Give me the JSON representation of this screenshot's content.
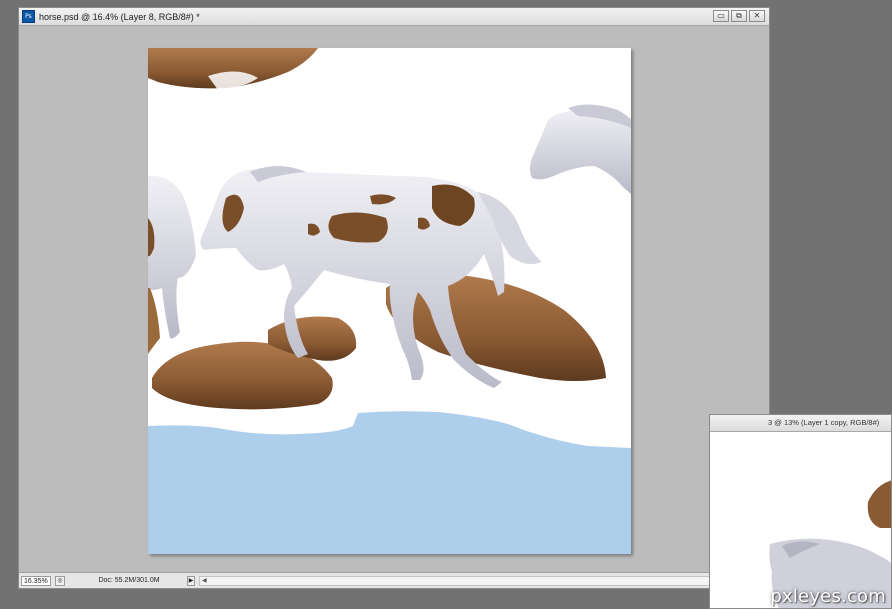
{
  "main_window": {
    "app_icon_label": "Ps",
    "title": "horse.psd @ 16.4% (Layer 8, RGB/8#) *",
    "buttons": {
      "minimize": "▭",
      "restore": "⧉",
      "close": "✕"
    },
    "status": {
      "zoom": "16.35%",
      "doc_info": "Doc: 55.2M/301.0M",
      "menu_arrow": "▶",
      "scroll_left": "◀"
    }
  },
  "second_window": {
    "title": "3 @ 13% (Layer 1 copy, RGB/8#)"
  },
  "watermark": "pxleyes.com",
  "colors": {
    "sky_blue": "#aecfec",
    "rock_brown": "#8a5a33",
    "horse_white": "#dcdde6",
    "paint_brown": "#7a4e28"
  }
}
